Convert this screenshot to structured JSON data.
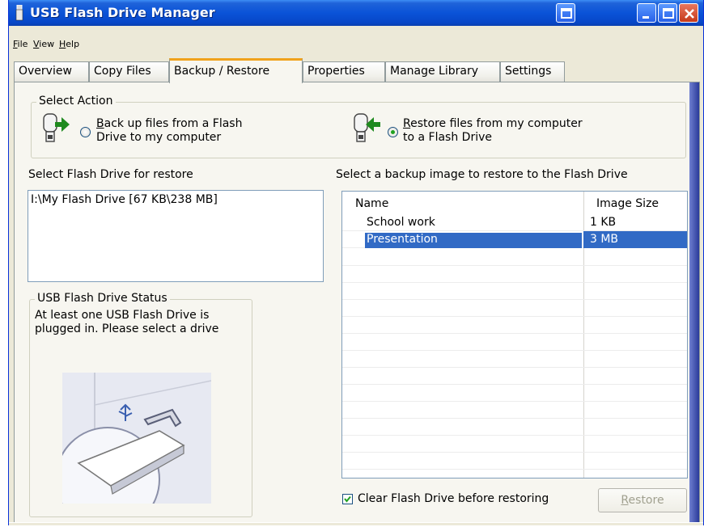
{
  "window": {
    "title": "USB Flash Drive Manager"
  },
  "menu": [
    {
      "label": "File",
      "accel": "F",
      "rest": "ile"
    },
    {
      "label": "View",
      "accel": "V",
      "rest": "iew"
    },
    {
      "label": "Help",
      "accel": "H",
      "rest": "elp"
    }
  ],
  "tabs": [
    {
      "label": "Overview"
    },
    {
      "label": "Copy Files"
    },
    {
      "label": "Backup / Restore",
      "active": true
    },
    {
      "label": "Properties"
    },
    {
      "label": "Manage Library"
    },
    {
      "label": "Settings"
    }
  ],
  "select_action": {
    "label": "Select Action",
    "backup": {
      "accel": "B",
      "line1_rest": "ack up files from a Flash",
      "line2": "Drive to my computer",
      "selected": false
    },
    "restore": {
      "accel": "R",
      "line1_rest": "estore files from my computer",
      "line2": "to a Flash Drive",
      "selected": true
    }
  },
  "flash_select": {
    "heading": "Select Flash Drive for restore",
    "items": [
      "I:\\My Flash Drive [67 KB\\238 MB]"
    ]
  },
  "status": {
    "label": "USB Flash Drive Status",
    "text": "At least one USB Flash Drive is plugged in. Please select a drive"
  },
  "backup_images": {
    "heading": "Select a backup image to restore to the Flash Drive",
    "columns": [
      "Name",
      "Image Size"
    ],
    "rows": [
      {
        "name": "School work",
        "size": "1 KB",
        "selected": false
      },
      {
        "name": "Presentation",
        "size": "3 MB",
        "selected": true
      }
    ]
  },
  "clear_option": {
    "label": "Clear Flash Drive before restoring",
    "checked": true
  },
  "restore_button": {
    "accel": "R",
    "rest": "estore",
    "enabled": false
  },
  "colors": {
    "titlebar": "#0a53d8",
    "selection": "#316ac5",
    "tab_highlight": "#f0a21c",
    "arrow_green": "#1f8a1f"
  }
}
